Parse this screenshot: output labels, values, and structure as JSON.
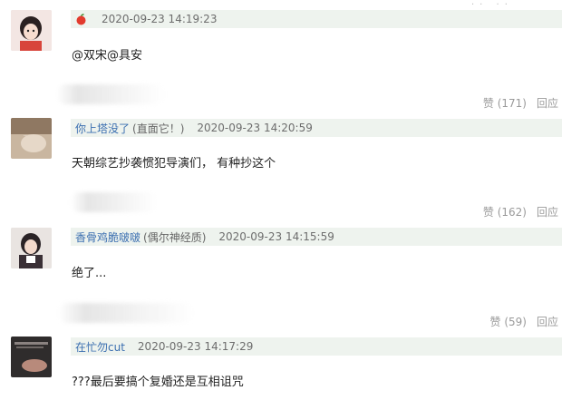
{
  "comments": [
    {
      "user": "",
      "tag": "",
      "time": "2020-09-23 14:19:23",
      "content": "@双宋@具安",
      "likes_label": "赞 (171)",
      "reply_label": "回应"
    },
    {
      "user": "你上塔没了",
      "tag": "(直面它！)",
      "time": "2020-09-23 14:20:59",
      "content": "天朝综艺抄袭惯犯导演们，  有种抄这个",
      "likes_label": "赞 (162)",
      "reply_label": "回应"
    },
    {
      "user": "香骨鸡脆啵啵",
      "tag": "(偶尔神经质)",
      "time": "2020-09-23 14:15:59",
      "content": "绝了...",
      "likes_label": "赞 (59)",
      "reply_label": "回应"
    },
    {
      "user": "在忙勿cut",
      "tag": "",
      "time": "2020-09-23 14:17:29",
      "content": "???最后要搞个复婚还是互相诅咒",
      "likes_label": "",
      "reply_label": ""
    }
  ],
  "icons": {
    "badge": "apple-icon"
  },
  "colors": {
    "meta_bar": "#eef3ee",
    "username": "#3b6fb0",
    "action": "#9a9a9a"
  }
}
